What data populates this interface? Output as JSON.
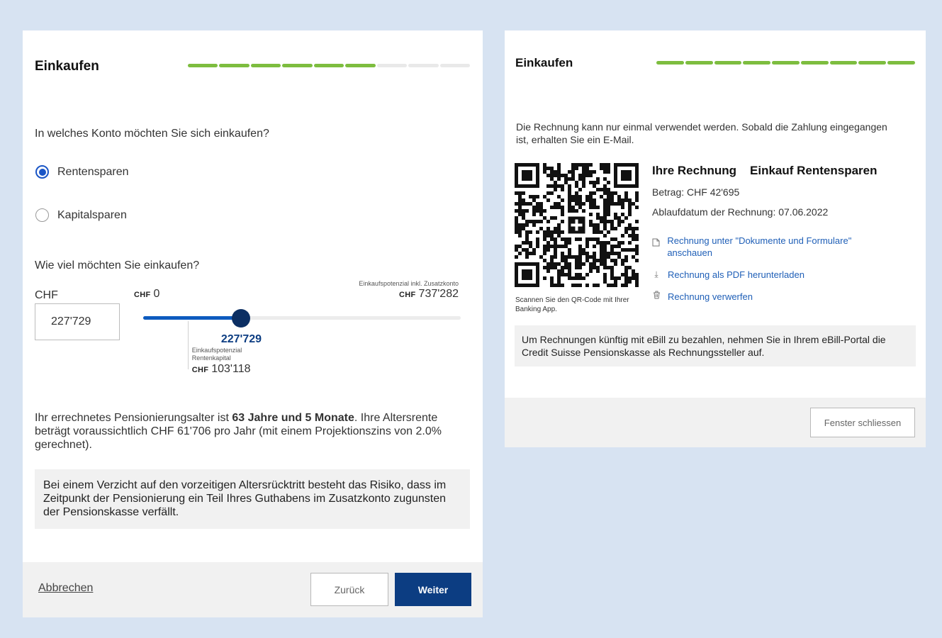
{
  "left": {
    "title": "Einkaufen",
    "progress": {
      "total": 9,
      "done": 6
    },
    "question_account": "In welches Konto möchten Sie sich einkaufen?",
    "options": [
      {
        "label": "Rentensparen",
        "selected": true
      },
      {
        "label": "Kapitalsparen",
        "selected": false
      }
    ],
    "question_amount": "Wie viel möchten Sie einkaufen?",
    "currency_label": "CHF",
    "currency_small": "CHF",
    "input_value": "227'729",
    "slider": {
      "min_label": "0",
      "max_caption": "Einkaufspotenzial inkl. Zusatzkonto",
      "max_label": "737'282",
      "value_label": "227'729",
      "value_fraction": 0.309,
      "marker_caption_1": "Einkaufspotenzial",
      "marker_caption_2": "Rentenkapital",
      "marker_label": "103'118",
      "marker_fraction": 0.14
    },
    "result": {
      "prefix": "Ihr errechnetes Pensionierungsalter ist ",
      "age_bold": "63 Jahre und 5 Monate",
      "suffix": ". Ihre Altersrente beträgt voraussichtlich CHF 61'706 pro Jahr (mit einem Projektionszins von 2.0% gerechnet)."
    },
    "note": "Bei einem Verzicht auf den vorzeitigen Altersrücktritt besteht das Risiko, dass im Zeitpunkt der Pensionierung ein Teil Ihres Guthabens im Zusatzkonto zugunsten der Pensionskasse verfällt.",
    "footer": {
      "cancel": "Abbrechen",
      "back": "Zurück",
      "next": "Weiter"
    }
  },
  "right": {
    "title": "Einkaufen",
    "progress": {
      "total": 9,
      "done": 9
    },
    "info": "Die Rechnung kann nur einmal verwendet werden. Sobald die Zahlung eingegangen ist, erhalten Sie ein E-Mail.",
    "invoice_heading_1": "Ihre Rechnung",
    "invoice_heading_2": "Einkauf Rentensparen",
    "amount": "Betrag: CHF 42'695",
    "expiry": "Ablaufdatum der Rechnung: 07.06.2022",
    "qr_caption": "Scannen Sie den QR-Code mit Ihrer Banking App.",
    "links": [
      {
        "label": "Rechnung unter \"Dokumente und Formulare\" anschauen",
        "icon": "document-icon"
      },
      {
        "label": "Rechnung als PDF herunterladen",
        "icon": "download-icon"
      },
      {
        "label": "Rechnung verwerfen",
        "icon": "trash-icon"
      }
    ],
    "ebill_note": "Um Rechnungen künftig mit eBill zu bezahlen, nehmen Sie in Ihrem eBill-Portal die Credit Suisse Pensionskasse als Rechnungssteller auf.",
    "close_button": "Fenster schliessen"
  },
  "colors": {
    "background": "#d7e3f2",
    "progress_done": "#7dbd3f",
    "primary": "#0c3d82",
    "slider_fill": "#0d5bbf",
    "slider_thumb": "#0c2f63",
    "link": "#1f5fb7"
  }
}
